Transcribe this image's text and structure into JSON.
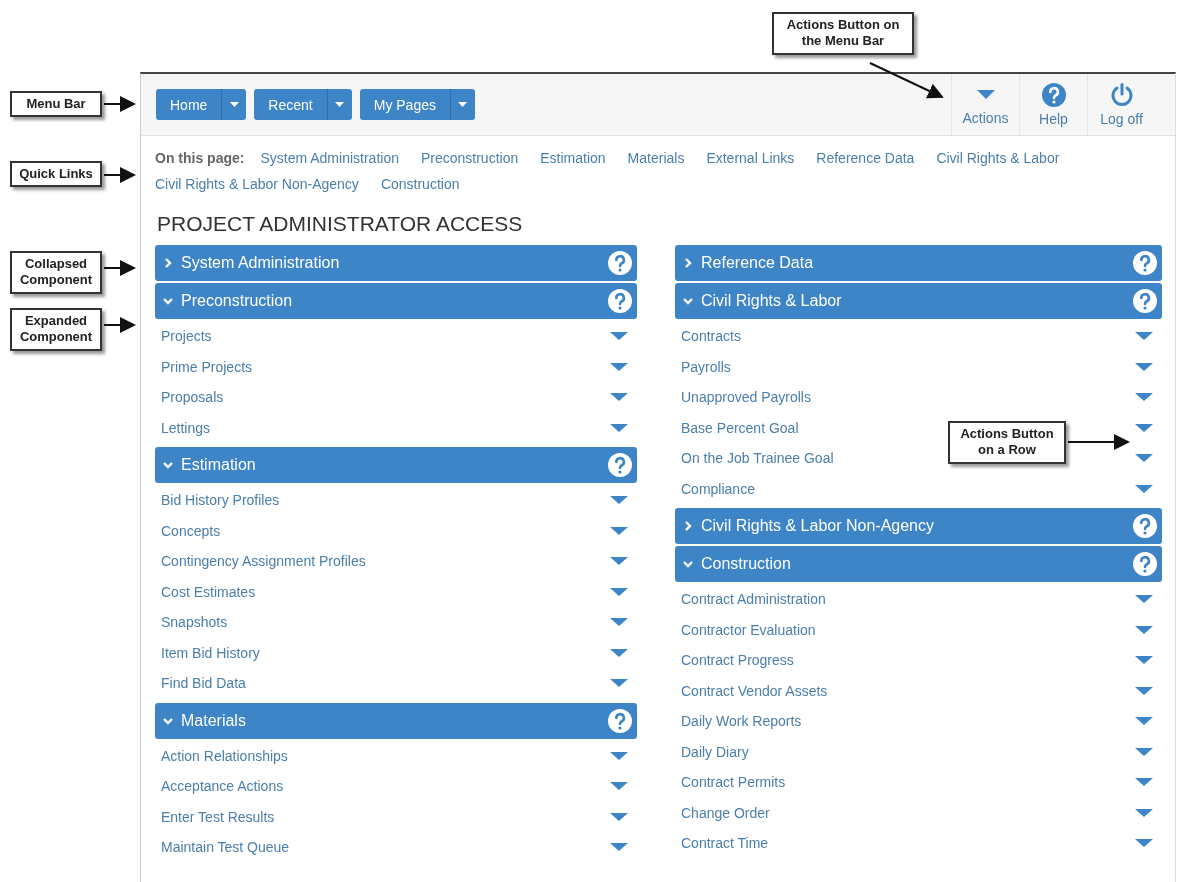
{
  "annotations": [
    {
      "text": "Menu Bar"
    },
    {
      "text": "Quick Links"
    },
    {
      "text": "Collapsed Component"
    },
    {
      "text": "Expanded Component"
    },
    {
      "text": "Actions Button on the Menu Bar"
    },
    {
      "text": "Actions Button on a Row"
    }
  ],
  "menu_bar": {
    "buttons": [
      {
        "label": "Home"
      },
      {
        "label": "Recent"
      },
      {
        "label": "My Pages"
      }
    ],
    "actions": [
      {
        "label": "Actions",
        "kind": "caret"
      },
      {
        "label": "Help",
        "kind": "help"
      },
      {
        "label": "Log off",
        "kind": "power"
      }
    ]
  },
  "quick_links": {
    "label": "On this page:",
    "links": [
      "System Administration",
      "Preconstruction",
      "Estimation",
      "Materials",
      "External Links",
      "Reference Data",
      "Civil Rights & Labor",
      "Civil Rights & Labor Non-Agency",
      "Construction"
    ]
  },
  "title": "PROJECT ADMINISTRATOR ACCESS",
  "columns": [
    {
      "sections": [
        {
          "title": "System Administration",
          "expanded": false
        },
        {
          "title": "Preconstruction",
          "expanded": true,
          "items": [
            "Projects",
            "Prime Projects",
            "Proposals",
            "Lettings"
          ]
        },
        {
          "title": "Estimation",
          "expanded": true,
          "items": [
            "Bid History Profiles",
            "Concepts",
            "Contingency Assignment Profiles",
            "Cost Estimates",
            "Snapshots",
            "Item Bid History",
            "Find Bid Data"
          ]
        },
        {
          "title": "Materials",
          "expanded": true,
          "items": [
            "Action Relationships",
            "Acceptance Actions",
            "Enter Test Results",
            "Maintain Test Queue"
          ]
        }
      ]
    },
    {
      "sections": [
        {
          "title": "Reference Data",
          "expanded": false
        },
        {
          "title": "Civil Rights & Labor",
          "expanded": true,
          "items": [
            "Contracts",
            "Payrolls",
            "Unapproved Payrolls",
            "Base Percent Goal",
            "On the Job Trainee Goal",
            "Compliance"
          ]
        },
        {
          "title": "Civil Rights & Labor Non-Agency",
          "expanded": false
        },
        {
          "title": "Construction",
          "expanded": true,
          "items": [
            "Contract Administration",
            "Contractor Evaluation",
            "Contract Progress",
            "Contract Vendor Assets",
            "Daily Work Reports",
            "Daily Diary",
            "Contract Permits",
            "Change Order",
            "Contract Time"
          ]
        }
      ]
    }
  ]
}
